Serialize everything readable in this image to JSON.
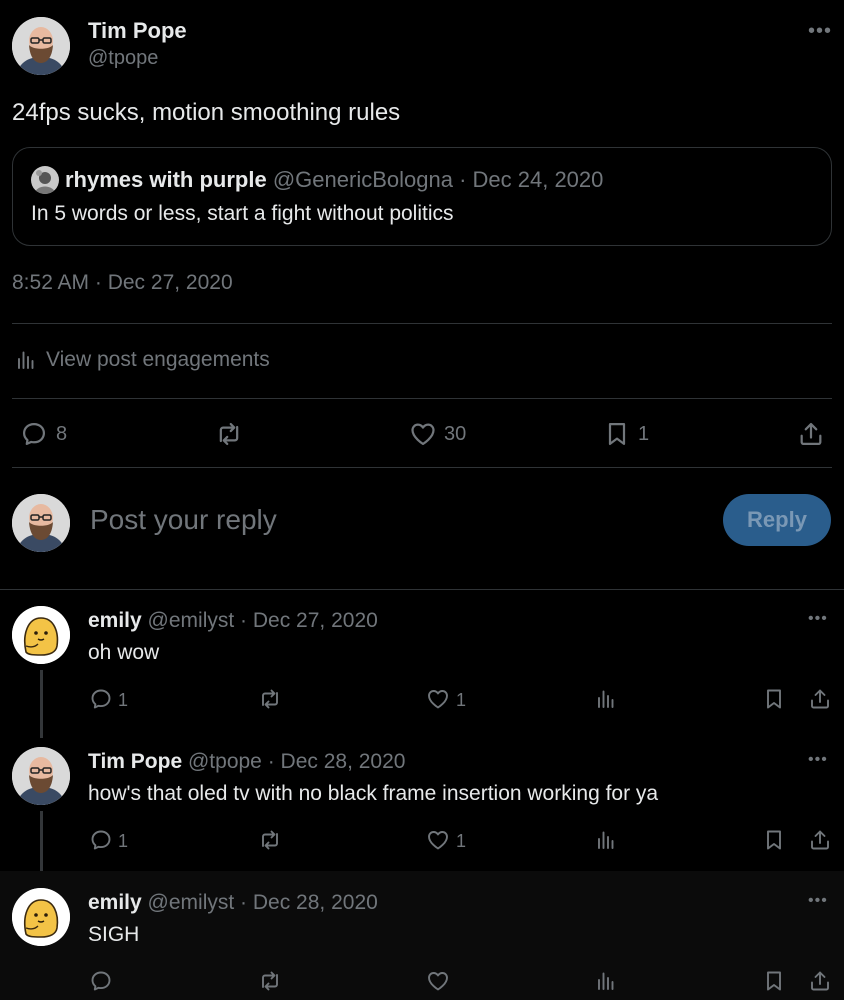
{
  "post": {
    "author_name": "Tim Pope",
    "author_handle": "@tpope",
    "text": "24fps sucks, motion smoothing rules",
    "timestamp": "8:52 AM · Dec 27, 2020",
    "quote": {
      "author_name": "rhymes with purple",
      "author_handle": "@GenericBologna",
      "date": "· Dec 24, 2020",
      "text": "In 5 words or less, start a fight without politics"
    },
    "view_engagements_label": "View post engagements",
    "stats": {
      "replies": "8",
      "likes": "30",
      "bookmarks": "1"
    }
  },
  "composer": {
    "placeholder": "Post your reply",
    "reply_label": "Reply"
  },
  "replies": [
    {
      "author_name": "emily",
      "author_handle": "@emilyst",
      "date": "· Dec 27, 2020",
      "text": "oh wow",
      "replies": "1",
      "likes": "1"
    },
    {
      "author_name": "Tim Pope",
      "author_handle": "@tpope",
      "date": "· Dec 28, 2020",
      "text": "how's that oled tv with no black frame insertion working for ya",
      "replies": "1",
      "likes": "1"
    },
    {
      "author_name": "emily",
      "author_handle": "@emilyst",
      "date": "· Dec 28, 2020",
      "text": "SIGH",
      "replies": "",
      "likes": ""
    }
  ],
  "colors": {
    "background": "#000000",
    "text": "#e7e9ea",
    "muted": "#71767b",
    "reply_button": "#2a5d8c"
  },
  "icons": [
    "more-icon",
    "reply-icon",
    "repost-icon",
    "like-icon",
    "bookmark-icon",
    "share-icon",
    "views-icon",
    "engagements-icon"
  ]
}
